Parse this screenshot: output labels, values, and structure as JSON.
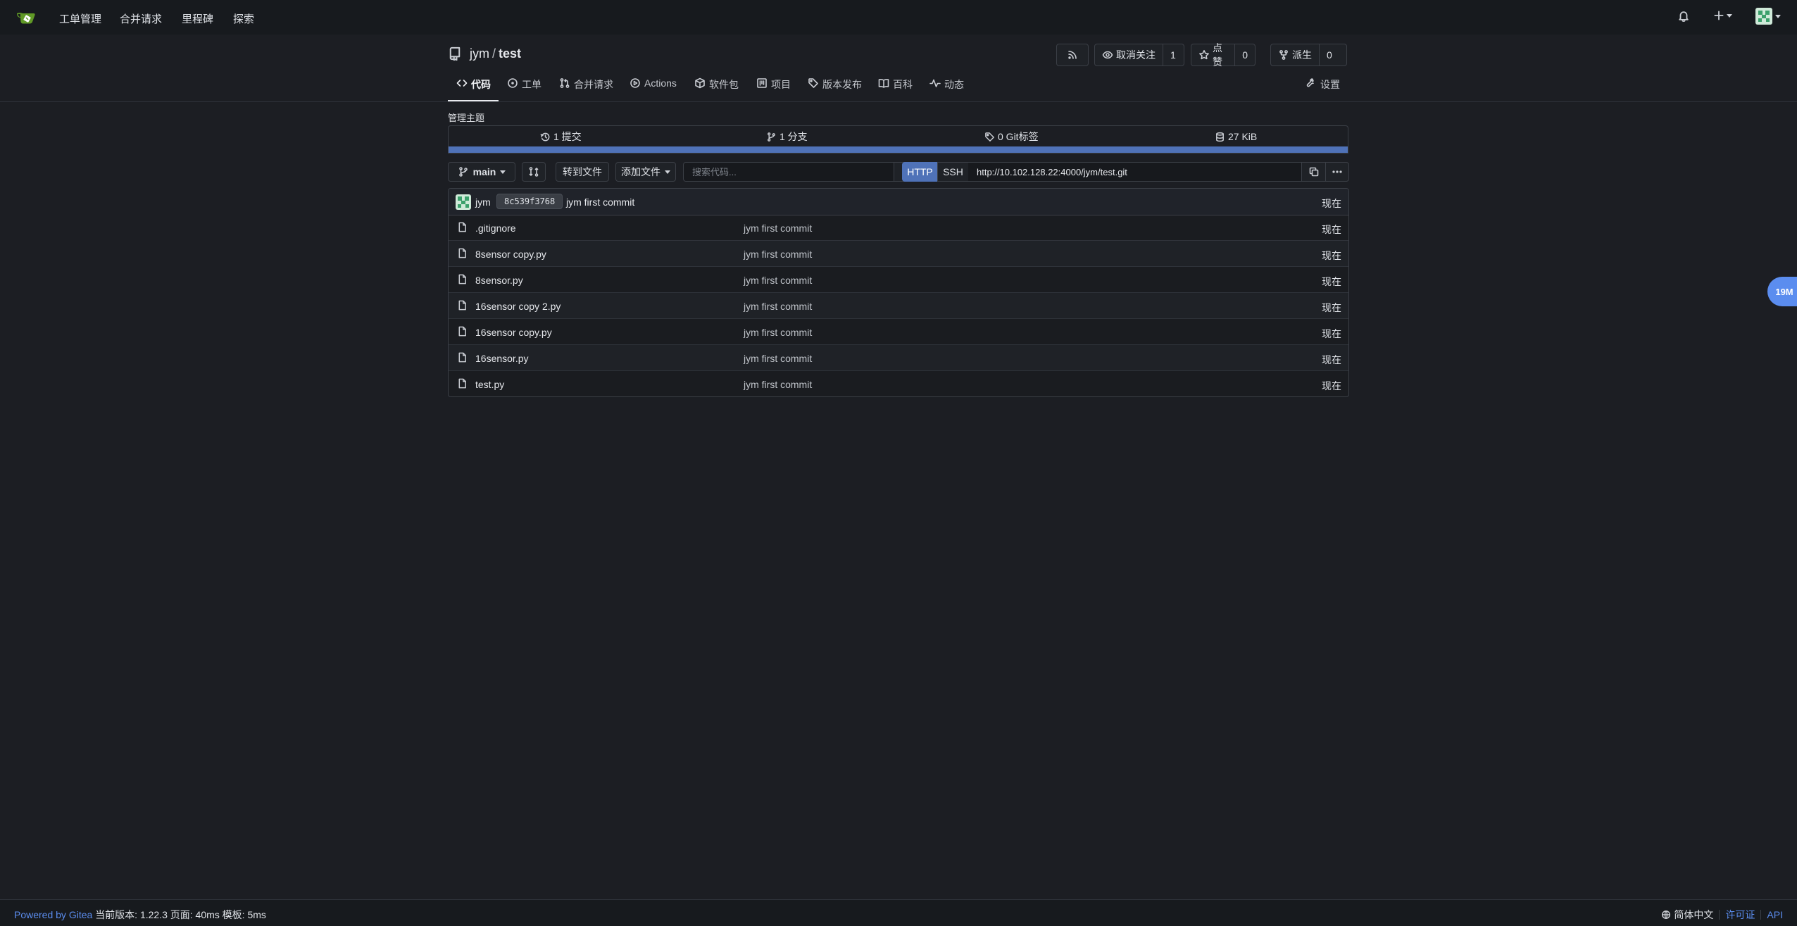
{
  "nav": {
    "items": [
      "工单管理",
      "合并请求",
      "里程碑",
      "探索"
    ]
  },
  "repo": {
    "owner": "jym",
    "separator": "/",
    "name": "test",
    "unwatch_label": "取消关注",
    "watch_count": "1",
    "star_label": "点赞",
    "star_count": "0",
    "fork_label": "派生",
    "fork_count": "0"
  },
  "tabs": [
    {
      "label": "代码",
      "icon": "code-icon",
      "active": true
    },
    {
      "label": "工单",
      "icon": "issue-icon"
    },
    {
      "label": "合并请求",
      "icon": "pull-request-icon"
    },
    {
      "label": "Actions",
      "icon": "play-icon"
    },
    {
      "label": "软件包",
      "icon": "package-icon"
    },
    {
      "label": "项目",
      "icon": "project-icon"
    },
    {
      "label": "版本发布",
      "icon": "tag-icon"
    },
    {
      "label": "百科",
      "icon": "book-icon"
    },
    {
      "label": "动态",
      "icon": "pulse-icon"
    }
  ],
  "settings_label": "设置",
  "topics_label": "管理主题",
  "stats": {
    "commits": "1 提交",
    "branches": "1 分支",
    "tags": "0 Git标签",
    "size": "27 KiB"
  },
  "language_bar_color": "#4f72b8",
  "toolbar": {
    "branch": "main",
    "goto_file": "转到文件",
    "add_file": "添加文件",
    "search_placeholder": "搜索代码...",
    "http_label": "HTTP",
    "ssh_label": "SSH",
    "clone_url": "http://10.102.128.22:4000/jym/test.git"
  },
  "latest_commit": {
    "author": "jym",
    "sha": "8c539f3768",
    "message": "jym first commit",
    "time": "现在"
  },
  "files": [
    {
      "name": ".gitignore",
      "message": "jym first commit",
      "time": "现在"
    },
    {
      "name": "8sensor copy.py",
      "message": "jym first commit",
      "time": "现在"
    },
    {
      "name": "8sensor.py",
      "message": "jym first commit",
      "time": "现在"
    },
    {
      "name": "16sensor copy 2.py",
      "message": "jym first commit",
      "time": "现在"
    },
    {
      "name": "16sensor copy.py",
      "message": "jym first commit",
      "time": "现在"
    },
    {
      "name": "16sensor.py",
      "message": "jym first commit",
      "time": "现在"
    },
    {
      "name": "test.py",
      "message": "jym first commit",
      "time": "现在"
    }
  ],
  "float_badge": "19M",
  "footer": {
    "powered": "Powered by Gitea",
    "version_info": "当前版本: 1.22.3 页面: 40ms 模板: 5ms",
    "language": "简体中文",
    "license": "许可证",
    "api": "API"
  },
  "colors": {
    "accent": "#5b8def",
    "http_active": "#4f72b8",
    "background": "#1c1e23"
  }
}
